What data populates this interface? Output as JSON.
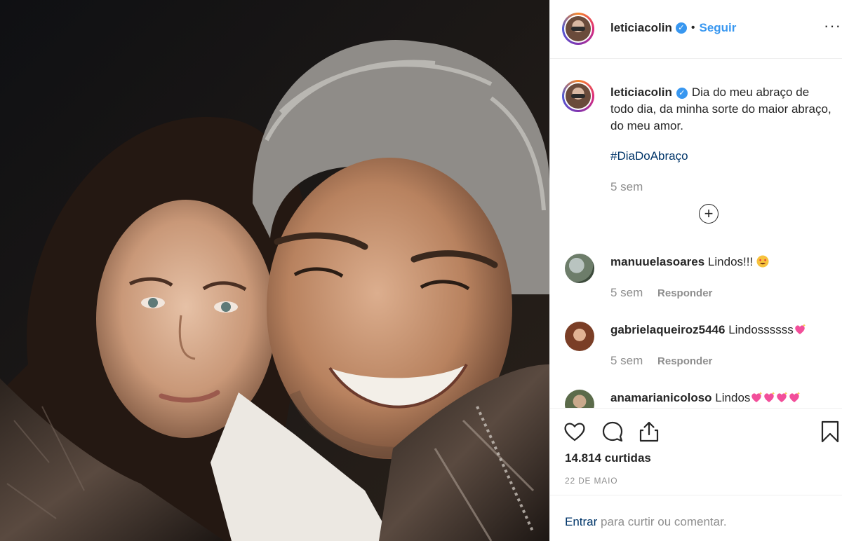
{
  "header": {
    "username": "leticiacolin",
    "separator": "•",
    "follow_label": "Seguir",
    "more_label": "···"
  },
  "caption": {
    "username": "leticiacolin",
    "text": "Dia do meu abraço de todo dia, da minha sorte do maior abraço, do meu amor.",
    "hashtag": "#DiaDoAbraço",
    "time": "5 sem",
    "load_more_label": "+"
  },
  "comments": [
    {
      "username": "manuuelasoares",
      "text": "Lindos!!!",
      "emoji": "heart-eyes-emoji",
      "time": "5 sem",
      "reply_label": "Responder"
    },
    {
      "username": "gabrielaqueiroz5446",
      "text": "Lindossssss",
      "emoji": "sparkling-heart-emoji",
      "time": "5 sem",
      "reply_label": "Responder"
    },
    {
      "username": "anamarianicoloso",
      "text": "Lindos",
      "emoji": "sparkling-heart-emoji",
      "time": "",
      "reply_label": ""
    }
  ],
  "actions": {
    "icons": [
      "heart-icon",
      "comment-icon",
      "share-icon",
      "bookmark-icon"
    ],
    "likes": "14.814 curtidas",
    "date": "22 DE MAIO"
  },
  "login": {
    "link_label": "Entrar",
    "rest_text": "para curtir ou comentar."
  },
  "colors": {
    "link_blue": "#3897f0",
    "hashtag_blue": "#003569",
    "muted": "#8e8e8e",
    "text": "#262626"
  }
}
